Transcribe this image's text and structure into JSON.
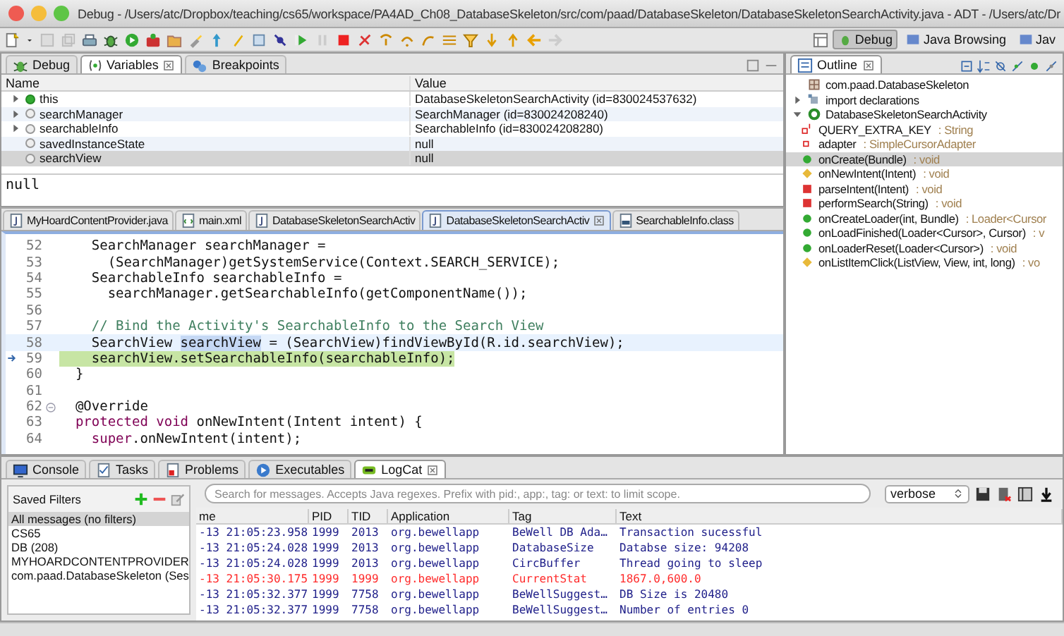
{
  "window": {
    "title": "Debug - /Users/atc/Dropbox/teaching/cs65/workspace/PA4AD_Ch08_DatabaseSkeleton/src/com/paad/DatabaseSkeleton/DatabaseSkeletonSearchActivity.java - ADT - /Users/atc/Dr"
  },
  "perspectives": [
    {
      "label": "Debug",
      "selected": true
    },
    {
      "label": "Java Browsing",
      "selected": false
    },
    {
      "label": "Jav",
      "selected": false
    }
  ],
  "variables_view": {
    "tabs": [
      {
        "label": "Debug",
        "kind": "debug",
        "selected": false
      },
      {
        "label": "Variables",
        "kind": "variables",
        "selected": true
      },
      {
        "label": "Breakpoints",
        "kind": "breakpoints",
        "selected": false
      }
    ],
    "columns": [
      "Name",
      "Value"
    ],
    "rows": [
      {
        "name": "this",
        "value": "DatabaseSkeletonSearchActivity  (id=830024537632)",
        "kind": "this",
        "expandable": true,
        "selected": false
      },
      {
        "name": "searchManager",
        "value": "SearchManager  (id=830024208240)",
        "kind": "local",
        "expandable": true,
        "selected": false
      },
      {
        "name": "searchableInfo",
        "value": "SearchableInfo  (id=830024208280)",
        "kind": "local",
        "expandable": true,
        "selected": false
      },
      {
        "name": "savedInstanceState",
        "value": "null",
        "kind": "local",
        "expandable": false,
        "selected": false
      },
      {
        "name": "searchView",
        "value": "null",
        "kind": "local",
        "expandable": false,
        "selected": true
      }
    ],
    "detail": "null"
  },
  "editor": {
    "tabs": [
      {
        "label": "MyHoardContentProvider.java",
        "kind": "java",
        "selected": false
      },
      {
        "label": "main.xml",
        "kind": "xml",
        "selected": false
      },
      {
        "label": "DatabaseSkeletonSearchActiv",
        "kind": "java",
        "selected": false
      },
      {
        "label": "DatabaseSkeletonSearchActiv",
        "kind": "java",
        "selected": true
      },
      {
        "label": "SearchableInfo.class",
        "kind": "class",
        "selected": false
      }
    ],
    "lines": [
      {
        "number": "52",
        "segments": [
          {
            "text": "    SearchManager searchManager =",
            "kind": "plain"
          }
        ]
      },
      {
        "number": "53",
        "segments": [
          {
            "text": "      (SearchManager)getSystemService(Context.SEARCH_SERVICE);",
            "kind": "plain"
          }
        ]
      },
      {
        "number": "54",
        "segments": [
          {
            "text": "    SearchableInfo searchableInfo =",
            "kind": "plain"
          }
        ]
      },
      {
        "number": "55",
        "segments": [
          {
            "text": "      searchManager.getSearchableInfo(getComponentName());",
            "kind": "plain"
          }
        ]
      },
      {
        "number": "56"
      },
      {
        "number": "57",
        "segments": [
          {
            "text": "    // Bind the Activity's SearchableInfo to the Search View",
            "kind": "comment"
          }
        ]
      },
      {
        "number": "58",
        "current": true,
        "segments": [
          {
            "text": "    SearchView ",
            "kind": "plain"
          },
          {
            "text": "searchView",
            "kind": "occurrence"
          },
          {
            "text": " = (SearchView)findViewById(R.id.searchView);",
            "kind": "plain"
          }
        ]
      },
      {
        "number": "59",
        "debug_current": true,
        "segments": [
          {
            "text": "    searchView.setSearchableInfo(searchableInfo);",
            "kind": "plain"
          }
        ]
      },
      {
        "number": "60",
        "segments": [
          {
            "text": "  }",
            "kind": "plain"
          }
        ]
      },
      {
        "number": "61"
      },
      {
        "number": "62",
        "fold": true,
        "segments": [
          {
            "text": "  @Override",
            "kind": "plain"
          }
        ]
      },
      {
        "number": "63",
        "segments": [
          {
            "text": "  protected void",
            "kind": "keyword"
          },
          {
            "text": " onNewIntent(Intent intent) {",
            "kind": "plain"
          }
        ]
      },
      {
        "number": "64",
        "segments": [
          {
            "text": "    super",
            "kind": "keyword"
          },
          {
            "text": ".onNewIntent(intent);",
            "kind": "plain"
          }
        ]
      }
    ]
  },
  "outline": {
    "tab": "Outline",
    "items": [
      {
        "label": "com.paad.DatabaseSkeleton",
        "kind": "package",
        "selected": false
      },
      {
        "label": "import declarations",
        "kind": "imports",
        "expanded": false,
        "selected": false
      },
      {
        "label": "DatabaseSkeletonSearchActivity",
        "kind": "class",
        "expanded": true,
        "selected": false,
        "children": [
          {
            "label": "QUERY_EXTRA_KEY",
            "type": ": String",
            "kind": "static-field",
            "selected": false
          },
          {
            "label": "adapter",
            "type": ": SimpleCursorAdapter",
            "kind": "field",
            "selected": false
          },
          {
            "label": "onCreate(Bundle)",
            "type": ": void",
            "kind": "public",
            "selected": true
          },
          {
            "label": "onNewIntent(Intent)",
            "type": ": void",
            "kind": "protected",
            "selected": false
          },
          {
            "label": "parseIntent(Intent)",
            "type": ": void",
            "kind": "private",
            "selected": false
          },
          {
            "label": "performSearch(String)",
            "type": ": void",
            "kind": "private",
            "selected": false
          },
          {
            "label": "onCreateLoader(int, Bundle)",
            "type": ": Loader<Cursor",
            "kind": "public",
            "selected": false
          },
          {
            "label": "onLoadFinished(Loader<Cursor>, Cursor)",
            "type": ": v",
            "kind": "public",
            "selected": false
          },
          {
            "label": "onLoaderReset(Loader<Cursor>)",
            "type": ": void",
            "kind": "public",
            "selected": false
          },
          {
            "label": "onListItemClick(ListView, View, int, long)",
            "type": ": vo",
            "kind": "protected",
            "selected": false
          }
        ]
      }
    ]
  },
  "bottom": {
    "tabs": [
      {
        "label": "Console",
        "kind": "console",
        "selected": false
      },
      {
        "label": "Tasks",
        "kind": "tasks",
        "selected": false
      },
      {
        "label": "Problems",
        "kind": "problems",
        "selected": false
      },
      {
        "label": "Executables",
        "kind": "executables",
        "selected": false
      },
      {
        "label": "LogCat",
        "kind": "logcat",
        "selected": true
      }
    ],
    "saved_filters": {
      "title": "Saved Filters",
      "items": [
        {
          "label": "All messages (no filters)",
          "selected": true
        },
        {
          "label": "CS65",
          "selected": false
        },
        {
          "label": "DB (208)",
          "selected": false
        },
        {
          "label": "MYHOARDCONTENTPROVIDER",
          "selected": false
        },
        {
          "label": "com.paad.DatabaseSkeleton (Ses",
          "selected": false
        }
      ]
    },
    "search": {
      "placeholder": "Search for messages. Accepts Java regexes. Prefix with pid:, app:, tag: or text: to limit scope."
    },
    "log_level": "verbose",
    "columns": [
      "me",
      "PID",
      "TID",
      "Application",
      "Tag",
      "Text"
    ],
    "rows": [
      {
        "time": "-13 21:05:23.958",
        "pid": "1999",
        "tid": "2013",
        "application": "org.bewellapp",
        "tag": "BeWell DB Ada…",
        "text": "Transaction sucessful",
        "color": "#20208a"
      },
      {
        "time": "-13 21:05:24.028",
        "pid": "1999",
        "tid": "2013",
        "application": "org.bewellapp",
        "tag": "DatabaseSize",
        "text": "Databse size: 94208",
        "color": "#20208a"
      },
      {
        "time": "-13 21:05:24.028",
        "pid": "1999",
        "tid": "2013",
        "application": "org.bewellapp",
        "tag": "CircBuffer",
        "text": "Thread going to sleep",
        "color": "#20208a"
      },
      {
        "time": "-13 21:05:30.175",
        "pid": "1999",
        "tid": "1999",
        "application": "org.bewellapp",
        "tag": "CurrentStat",
        "text": "1867.0,600.0",
        "color": "#ff2a2a"
      },
      {
        "time": "-13 21:05:32.377",
        "pid": "1999",
        "tid": "7758",
        "application": "org.bewellapp",
        "tag": "BeWellSuggest…",
        "text": "DB Size is 20480",
        "color": "#20208a"
      },
      {
        "time": "-13 21:05:32.377",
        "pid": "1999",
        "tid": "7758",
        "application": "org.bewellapp",
        "tag": "BeWellSuggest…",
        "text": "Number of entries 0",
        "color": "#20208a"
      }
    ]
  }
}
